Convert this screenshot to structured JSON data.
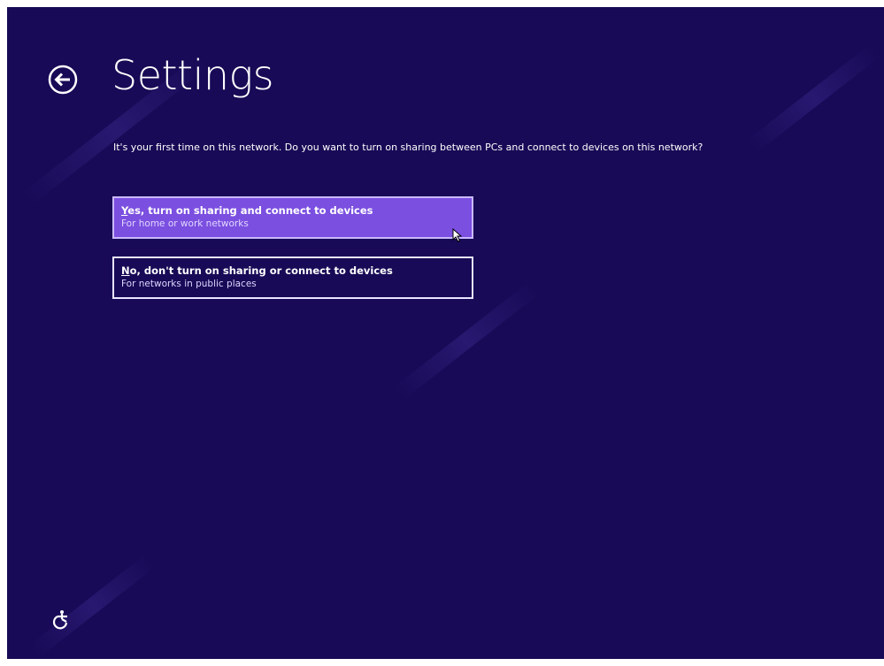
{
  "page": {
    "title": "Settings",
    "prompt": "It's your first time on this network. Do you want to turn on sharing between PCs and connect to devices on this network?"
  },
  "options": [
    {
      "accesskey": "Y",
      "title_rest": "es, turn on sharing and connect to devices",
      "subtitle": "For home or work networks",
      "selected": true
    },
    {
      "accesskey": "N",
      "title_rest": "o, don't turn on sharing or connect to devices",
      "subtitle": "For networks in public places",
      "selected": false
    }
  ],
  "icons": {
    "back": "back-arrow-circle-icon",
    "ease_of_access": "ease-of-access-icon",
    "cursor": "mouse-pointer-icon"
  },
  "colors": {
    "background": "#180a56",
    "selected_option": "#7b4fe0",
    "text": "#ffffff"
  }
}
